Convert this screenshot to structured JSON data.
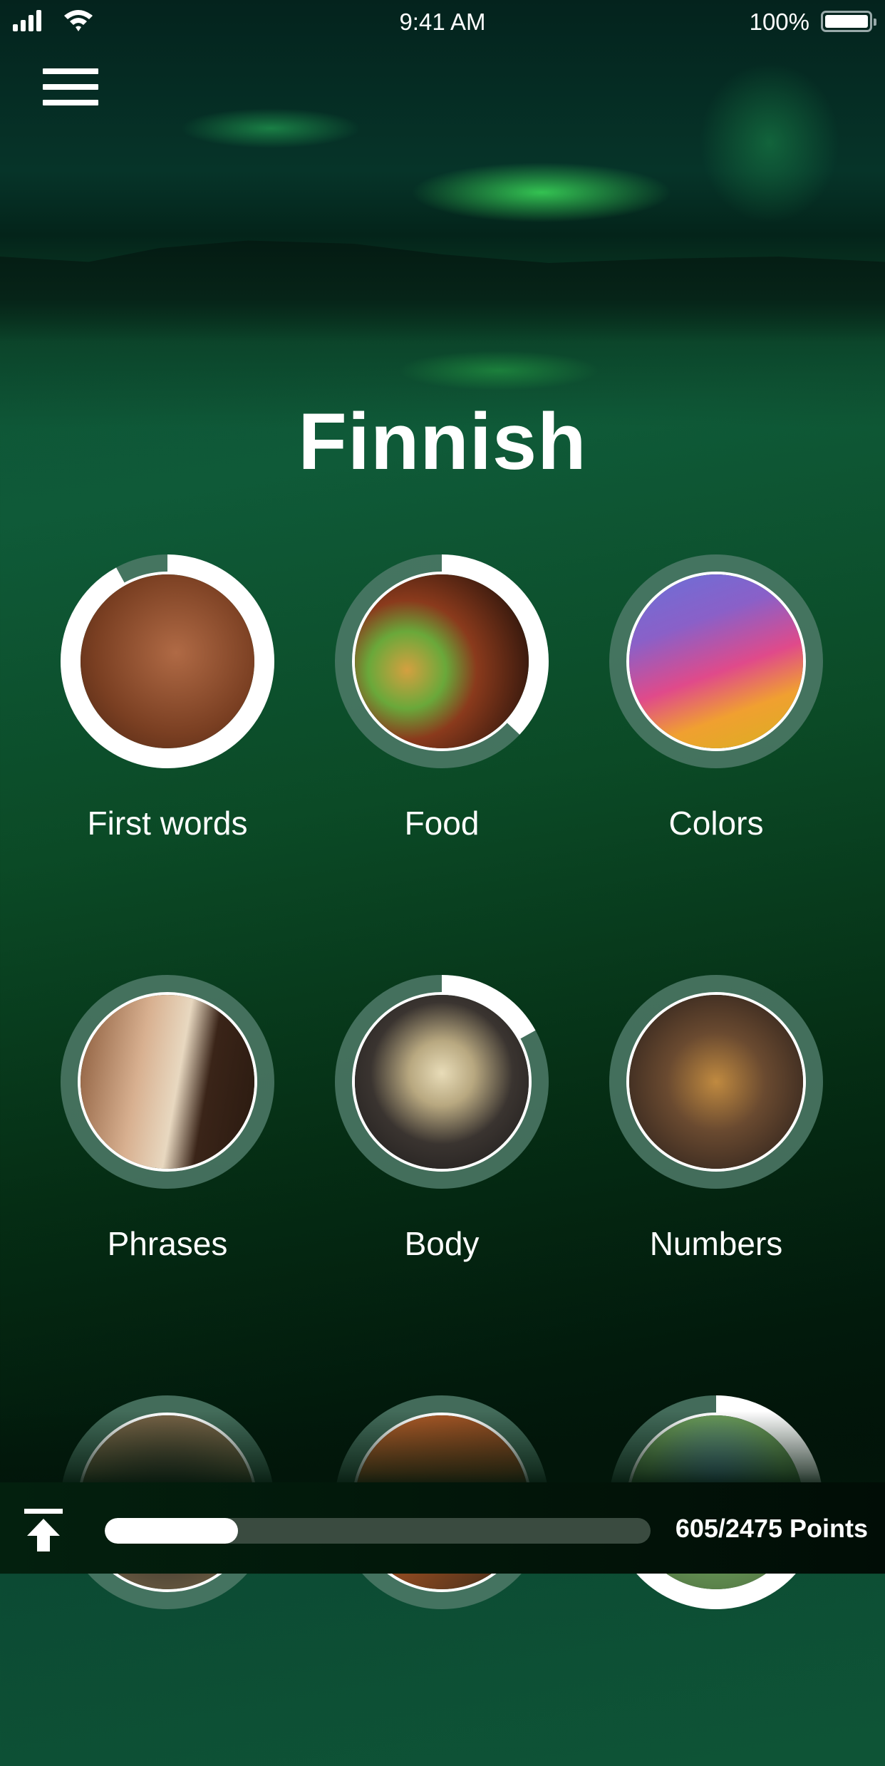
{
  "status_bar": {
    "time": "9:41 AM",
    "battery": "100%",
    "signal_icon": "cellular-signal-icon",
    "wifi_icon": "wifi-icon",
    "battery_icon": "battery-icon"
  },
  "header": {
    "menu_icon": "hamburger-menu-icon",
    "title": "Finnish"
  },
  "colors": {
    "ring_progress": "#ffffff",
    "ring_track": "#4f7a68",
    "progress_track": "#3a4b40",
    "progress_fill": "#ffffff"
  },
  "categories": [
    {
      "label": "First words",
      "image": "smiling-child-photo",
      "progress": 0.92
    },
    {
      "label": "Food",
      "image": "burger-and-soda-photo",
      "progress": 0.37
    },
    {
      "label": "Colors",
      "image": "color-powder-photo",
      "progress": 0
    },
    {
      "label": "Phrases",
      "image": "smiling-woman-photo",
      "progress": 0
    },
    {
      "label": "Body",
      "image": "skeleton-photo",
      "progress": 0.17
    },
    {
      "label": "Numbers",
      "image": "wooden-numbers-photo",
      "progress": 0
    },
    {
      "label": "",
      "image": "headphones-photo",
      "progress": 0
    },
    {
      "label": "",
      "image": "kitchen-photo",
      "progress": 0
    },
    {
      "label": "",
      "image": "map-with-pins-photo",
      "progress": 0.75
    }
  ],
  "footer": {
    "up_icon": "scroll-to-top-icon",
    "points_current": 605,
    "points_total": 2475,
    "points_label": "605/2475 Points",
    "progress_fraction": 0.244
  }
}
